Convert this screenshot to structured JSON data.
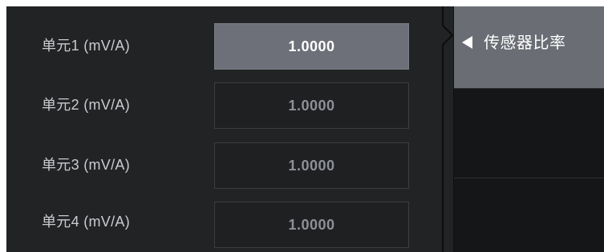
{
  "sensor_ratio": {
    "rows": [
      {
        "label": "单元1 (mV/A)",
        "value": "1.0000"
      },
      {
        "label": "单元2 (mV/A)",
        "value": "1.0000"
      },
      {
        "label": "单元3 (mV/A)",
        "value": "1.0000"
      },
      {
        "label": "单元4 (mV/A)",
        "value": "1.0000"
      }
    ],
    "selected_row": 1
  },
  "menu": {
    "active_label": "传感器比率",
    "arrow_icon": "left-triangle-icon"
  },
  "colors": {
    "panel_bg": "#222325",
    "selected_field": "#6d7078",
    "menu_active": "#6a6d74"
  }
}
